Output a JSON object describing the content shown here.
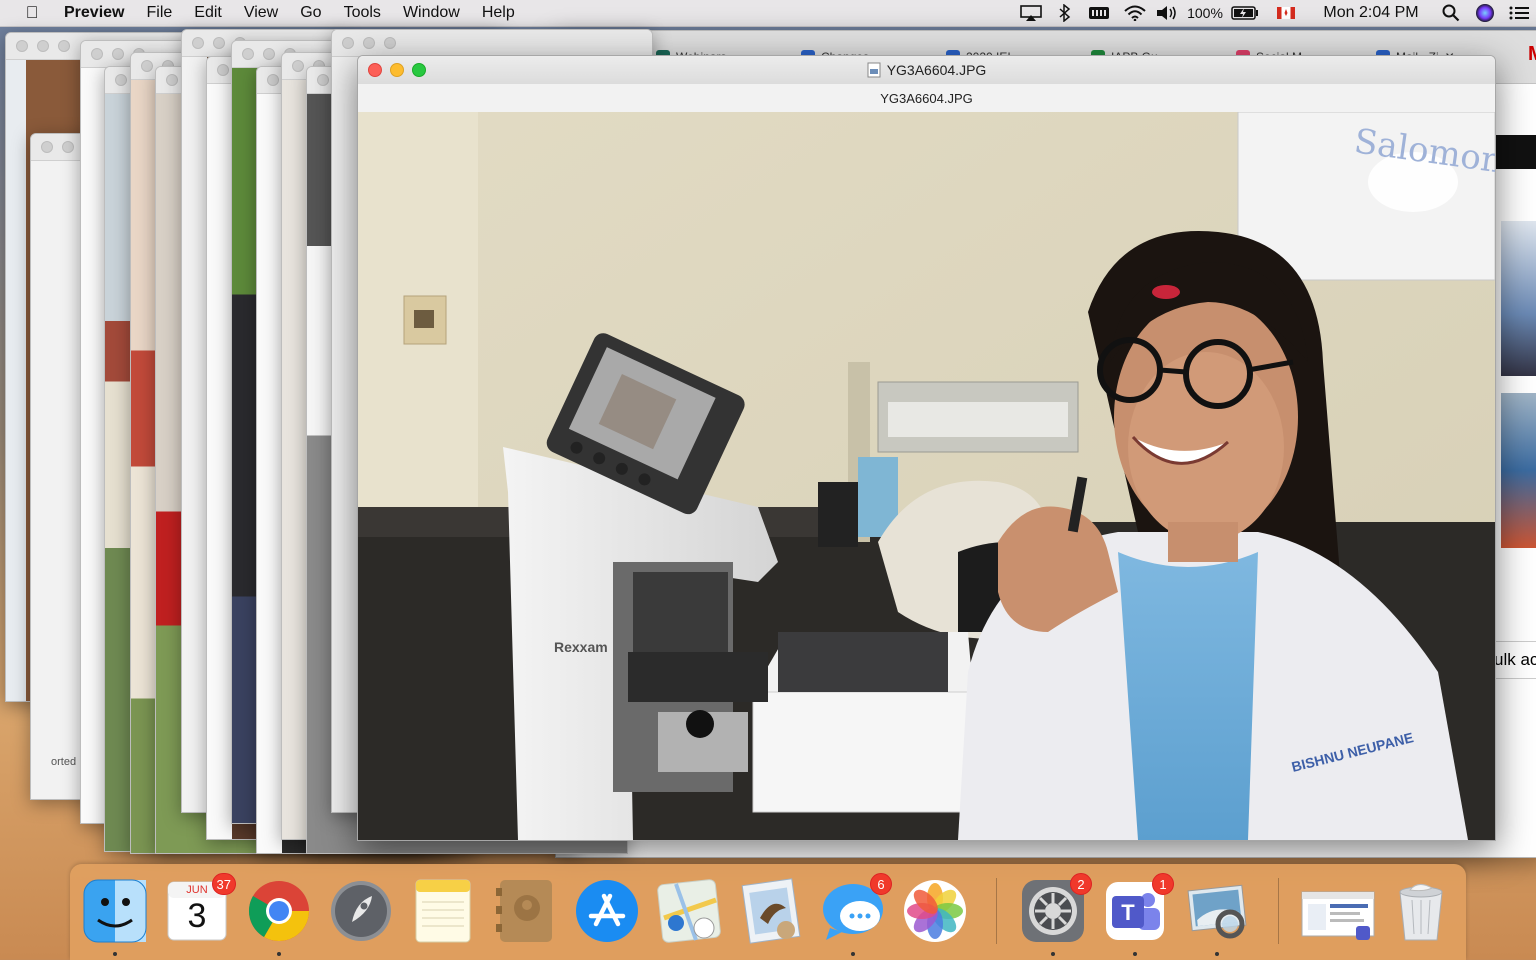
{
  "menubar": {
    "app_name": "Preview",
    "menus": [
      "File",
      "Edit",
      "View",
      "Go",
      "Tools",
      "Window",
      "Help"
    ],
    "battery": "100%",
    "clock": "Mon 2:04 PM"
  },
  "browser": {
    "tabs": [
      "Webinars",
      "Changes",
      "2020 IEI",
      "IAPB Gu",
      "Social M",
      "Mail - Zi"
    ],
    "side_text": "ulk ac",
    "partial_text_left": "orted"
  },
  "preview": {
    "window_title": "YG3A6604.JPG",
    "document_title": "YG3A6604.JPG",
    "photo_texts": {
      "machine_brand": "Rexxam",
      "name_tag": "BISHNU NEUPANE",
      "whiteboard": "Salomon"
    }
  },
  "dock": {
    "calendar_month": "JUN",
    "calendar_day": "3",
    "badges": {
      "calendar": "37",
      "messages": "6",
      "system_preferences": "2",
      "teams": "1"
    }
  }
}
